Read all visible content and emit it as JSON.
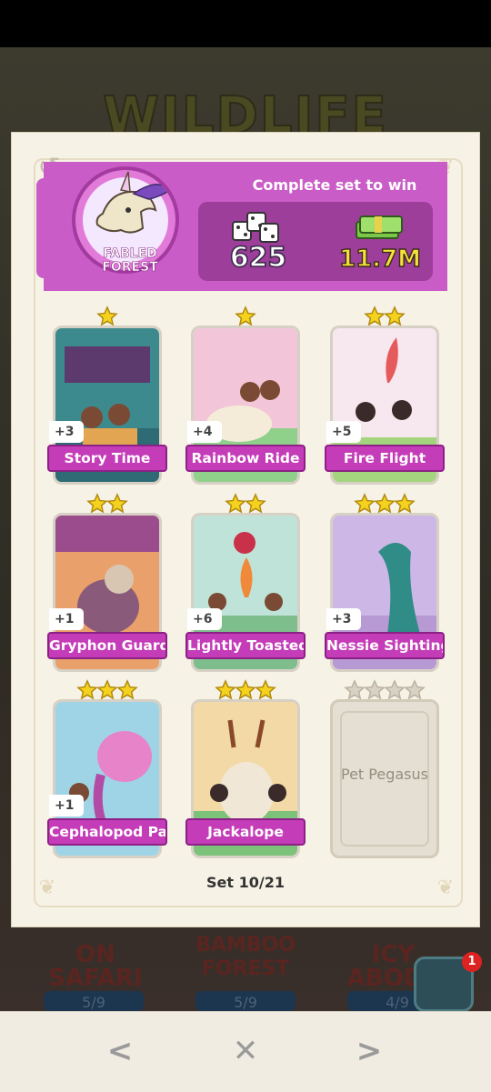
{
  "background": {
    "title": "WILDLIFE",
    "sets": [
      {
        "name": "ON SAFARI",
        "count": "5/9"
      },
      {
        "name": "BAMBOO FOREST",
        "count": "5/9"
      },
      {
        "name": "ICY ABODE",
        "count": "4/9"
      }
    ],
    "badge": "1"
  },
  "set": {
    "name": "FABLED FOREST",
    "reward_label": "Complete set to win",
    "dice_reward": "625",
    "cash_reward": "11.7M",
    "progress": "Set 10/21"
  },
  "cards": [
    {
      "name": "Story Time",
      "stars": 1,
      "duplicates": "+3",
      "collected": true
    },
    {
      "name": "Rainbow Ride",
      "stars": 1,
      "duplicates": "+4",
      "collected": true
    },
    {
      "name": "Fire Flight",
      "stars": 2,
      "duplicates": "+5",
      "collected": true
    },
    {
      "name": "Gryphon Guard",
      "stars": 2,
      "duplicates": "+1",
      "collected": true
    },
    {
      "name": "Lightly Toasted",
      "stars": 2,
      "duplicates": "+6",
      "collected": true
    },
    {
      "name": "Nessie Sighting",
      "stars": 3,
      "duplicates": "+3",
      "collected": true
    },
    {
      "name": "Cephalopod Pal",
      "stars": 3,
      "duplicates": "+1",
      "collected": true
    },
    {
      "name": "Jackalope",
      "stars": 3,
      "duplicates": "",
      "collected": true
    },
    {
      "name": "Pet Pegasus",
      "stars": 4,
      "duplicates": "",
      "collected": false
    }
  ],
  "nav": {
    "prev": "<",
    "close": "✕",
    "next": ">"
  },
  "colors": {
    "accent": "#c95cc6",
    "label_bg": "#c43cb8",
    "star": "#f5d21e"
  }
}
